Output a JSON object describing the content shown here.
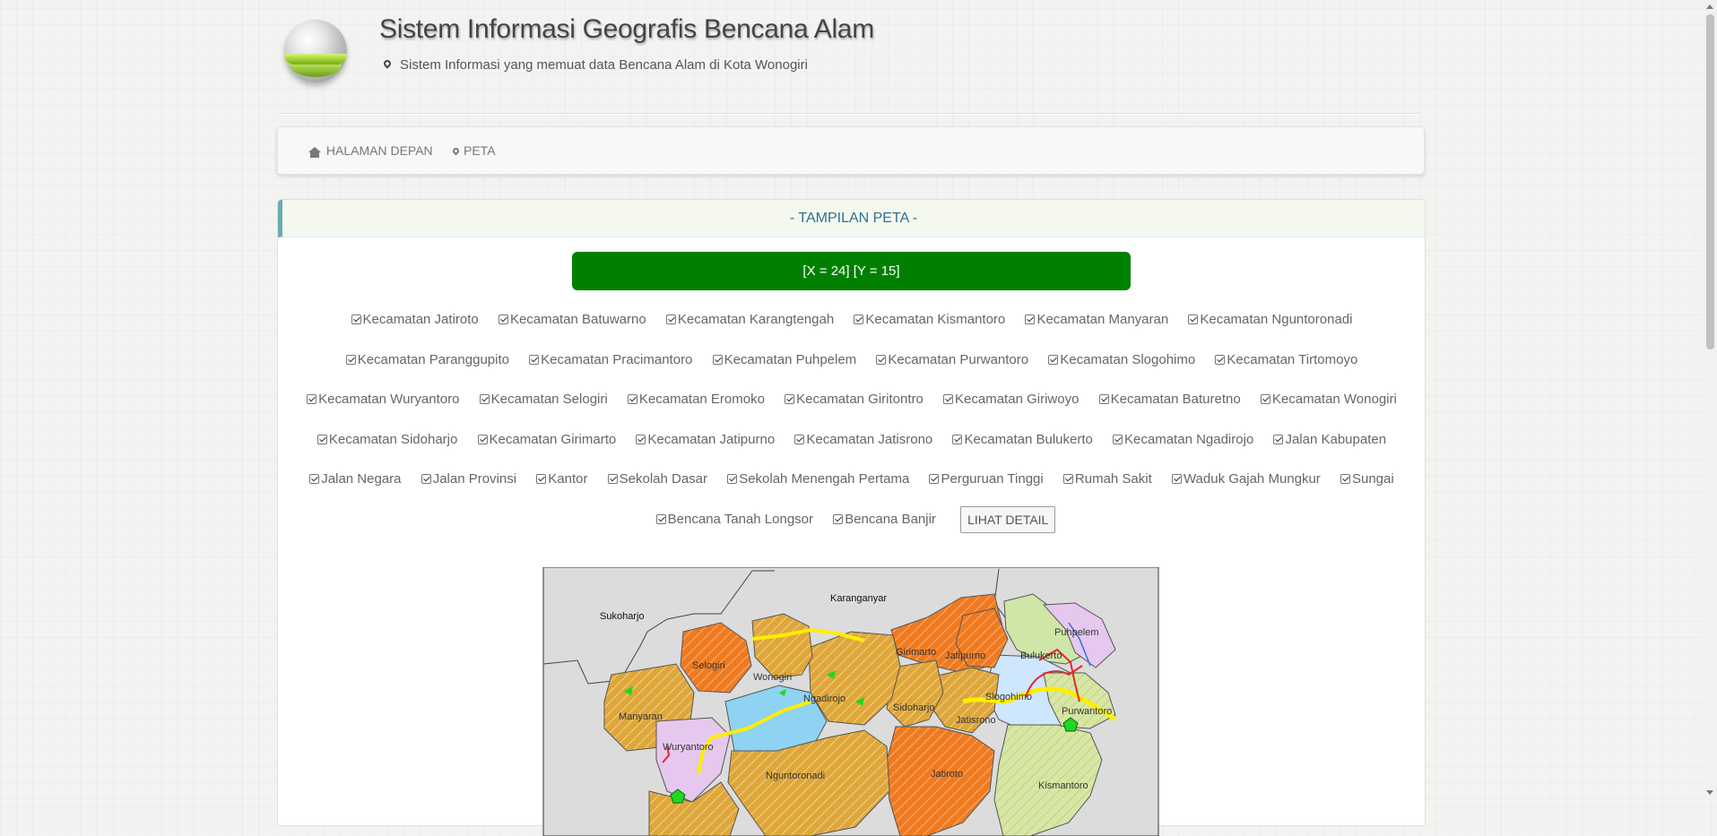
{
  "header": {
    "title": "Sistem Informasi Geografis Bencana Alam",
    "subtitle": "Sistem Informasi yang memuat data Bencana Alam di Kota Wonogiri"
  },
  "nav": {
    "home_label": "HALAMAN DEPAN",
    "map_label": "PETA"
  },
  "panel": {
    "heading": "- TAMPILAN PETA -",
    "coord": "[X = 24] [Y = 15]"
  },
  "layers": [
    "Kecamatan Jatiroto",
    "Kecamatan Batuwarno",
    "Kecamatan Karangtengah",
    "Kecamatan Kismantoro",
    "Kecamatan Manyaran",
    "Kecamatan Nguntoronadi",
    "Kecamatan Paranggupito",
    "Kecamatan Pracimantoro",
    "Kecamatan Puhpelem",
    "Kecamatan Purwantoro",
    "Kecamatan Slogohimo",
    "Kecamatan Tirtomoyo",
    "Kecamatan Wuryantoro",
    "Kecamatan Selogiri",
    "Kecamatan Eromoko",
    "Kecamatan Giritontro",
    "Kecamatan Giriwoyo",
    "Kecamatan Baturetno",
    "Kecamatan Wonogiri",
    "Kecamatan Sidoharjo",
    "Kecamatan Girimarto",
    "Kecamatan Jatipurno",
    "Kecamatan Jatisrono",
    "Kecamatan Bulukerto",
    "Kecamatan Ngadirojo",
    "Jalan Kabupaten",
    "Jalan Negara",
    "Jalan Provinsi",
    "Kantor",
    "Sekolah Dasar",
    "Sekolah Menengah Pertama",
    "Perguruan Tinggi",
    "Rumah Sakit",
    "Waduk Gajah Mungkur",
    "Sungai",
    "Bencana Tanah Longsor",
    "Bencana Banjir"
  ],
  "detail_button": "LIHAT DETAIL",
  "map_labels": {
    "sukoharjo": "Sukoharjo",
    "karanganyar": "Karanganyar",
    "selogiri": "Selogiri",
    "wonogiri": "Wonogiri",
    "girimarto": "Girimarto",
    "jatipurno": "Jatipurno",
    "bulukerto": "Bulukerto",
    "puhpelem": "Puhpelem",
    "slogohimo": "Slogohimo",
    "manyaran": "Manyaran",
    "ngadirojo": "Ngadirojo",
    "sidoharjo": "Sidoharjo",
    "jatisrono": "Jatisrono",
    "purwantoro": "Purwantoro",
    "wuryantoro": "Wuryantoro",
    "nguntoronadi": "Nguntoronadi",
    "jatiroto": "Jatiroto",
    "kismantoro": "Kismantoro"
  },
  "colors": {
    "coord_bg": "#008000",
    "panel_heading_text": "#31708f",
    "orange": "#f07a20",
    "gold": "#dfa63a",
    "road": "#ffee00",
    "river": "#e3262a",
    "reservoir": "#8fd3f2"
  }
}
